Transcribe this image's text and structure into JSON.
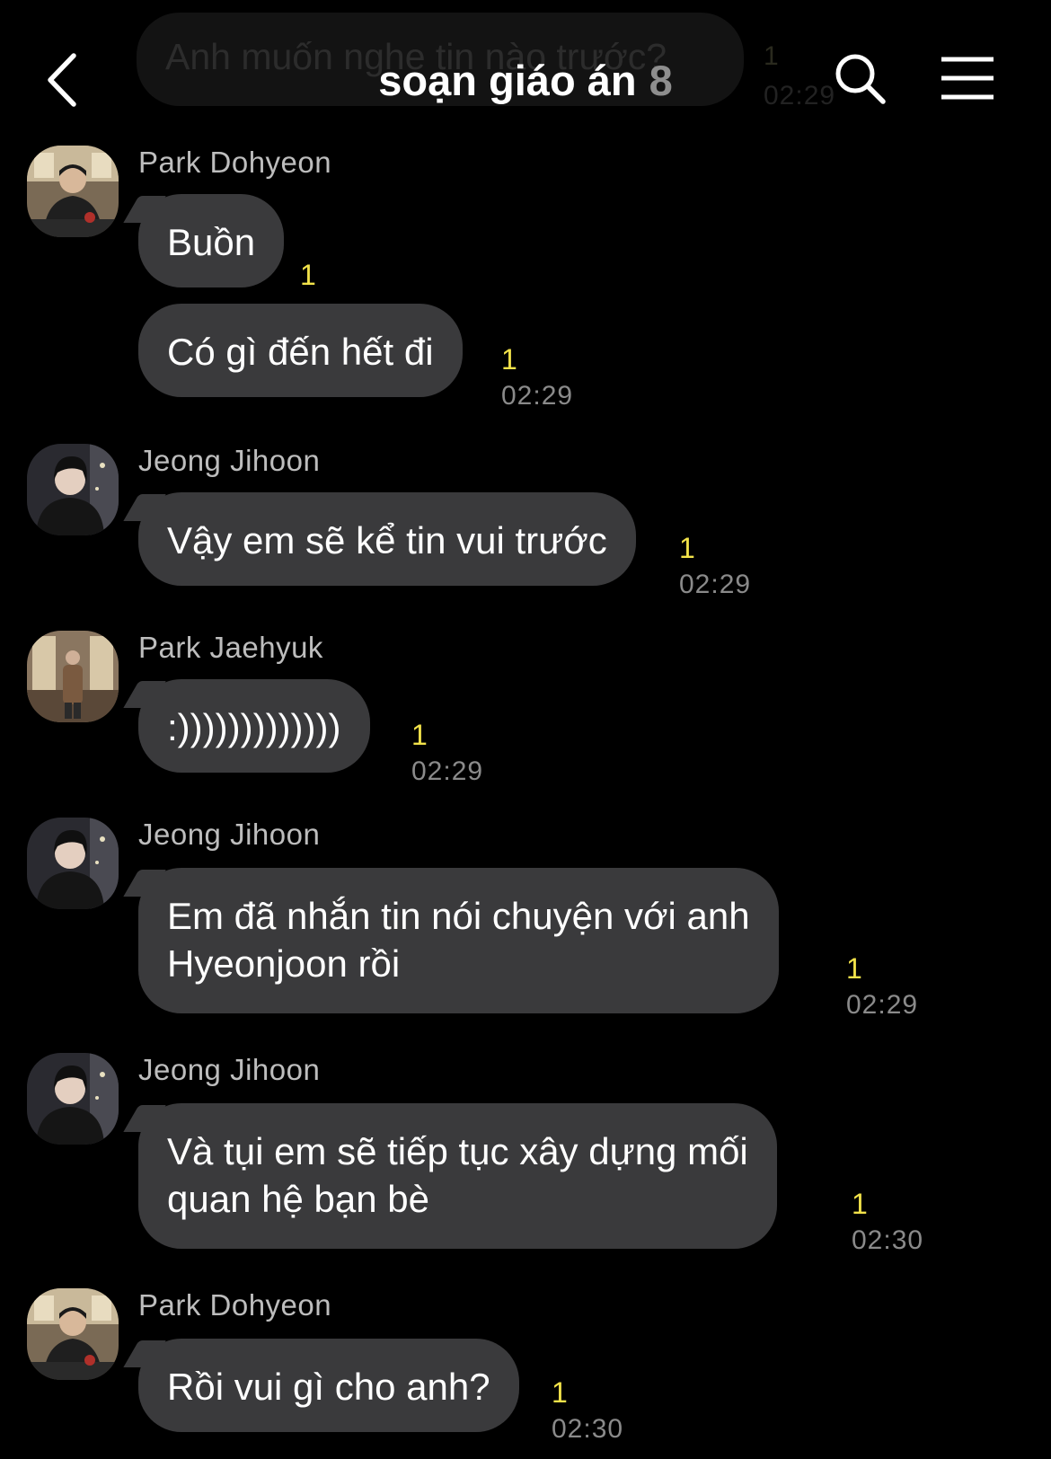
{
  "header": {
    "title": "soạn giáo án",
    "member_count": "8",
    "ghost_text": "Anh muốn nghe tin nào trước?",
    "ghost_unread": "1",
    "ghost_time": "02:29"
  },
  "icons": {
    "back": "chevron-left-icon",
    "search": "search-icon",
    "menu": "hamburger-menu-icon"
  },
  "colors": {
    "background": "#000000",
    "bubble": "#3a3a3c",
    "unread": "#f2e24a",
    "time": "#8a8a8a"
  },
  "messages": [
    {
      "sender": "Park Dohyeon",
      "text": "Buồn",
      "unread": "1",
      "time": ""
    },
    {
      "sender": "",
      "text": "Có gì đến hết đi",
      "unread": "1",
      "time": "02:29"
    },
    {
      "sender": "Jeong Jihoon",
      "text": "Vậy em sẽ kể tin vui trước",
      "unread": "1",
      "time": "02:29"
    },
    {
      "sender": "Park Jaehyuk",
      "text": ":)))))))))))))",
      "unread": "1",
      "time": "02:29"
    },
    {
      "sender": "Jeong Jihoon",
      "line1": "Em đã nhắn tin nói chuyện với anh",
      "line2": "Hyeonjoon rồi",
      "unread": "1",
      "time": "02:29"
    },
    {
      "sender": "Jeong Jihoon",
      "line1": "Và tụi em sẽ tiếp tục xây dựng mối",
      "line2": "quan hệ bạn bè",
      "unread": "1",
      "time": "02:30"
    },
    {
      "sender": "Park Dohyeon",
      "text": "Rồi vui gì cho anh?",
      "unread": "1",
      "time": "02:30"
    }
  ]
}
